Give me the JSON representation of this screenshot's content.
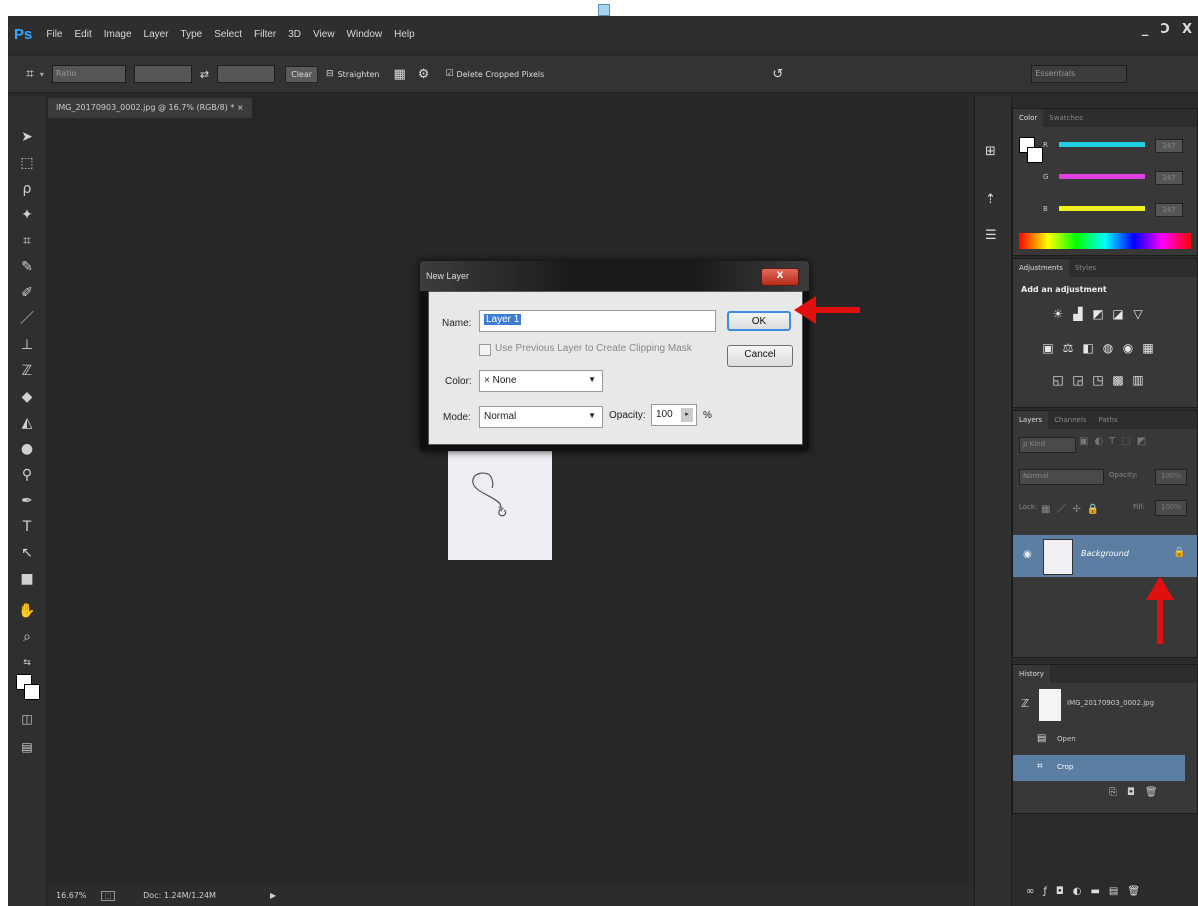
{
  "app": {
    "logo": "Ps",
    "menu": [
      "File",
      "Edit",
      "Image",
      "Layer",
      "Type",
      "Select",
      "Filter",
      "3D",
      "View",
      "Window",
      "Help"
    ],
    "window_controls": [
      "_",
      "Ɔ",
      "X"
    ]
  },
  "options_bar": {
    "ratio": "Ratio",
    "clear": "Clear",
    "straighten": "Straighten",
    "delete_cropped": "Delete Cropped Pixels",
    "workspace": "Essentials"
  },
  "document": {
    "tab_title": "IMG_20170903_0002.jpg @ 16.7% (RGB/8) * ×"
  },
  "status": {
    "zoom": "16.67%",
    "doc": "Doc: 1.24M/1.24M"
  },
  "color_panel": {
    "tabs": [
      "Color",
      "Swatches"
    ],
    "channels": [
      {
        "label": "R",
        "value": "247",
        "color": "#20d0e0"
      },
      {
        "label": "G",
        "value": "247",
        "color": "#e040e0"
      },
      {
        "label": "B",
        "value": "247",
        "color": "#f0f020"
      }
    ]
  },
  "adjustments_panel": {
    "tabs": [
      "Adjustments",
      "Styles"
    ],
    "heading": "Add an adjustment"
  },
  "layers_panel": {
    "tabs": [
      "Layers",
      "Channels",
      "Paths"
    ],
    "kind": "ρ Kind",
    "blend": "Normal",
    "opacity_label": "Opacity:",
    "opacity_value": "100%",
    "lock_label": "Lock:",
    "fill_label": "Fill:",
    "fill_value": "100%",
    "layer_name": "Background"
  },
  "history_panel": {
    "tab": "History",
    "snapshot": "IMG_20170903_0002.jpg",
    "steps": [
      "Open",
      "Crop"
    ]
  },
  "dialog": {
    "title": "New Layer",
    "close": "X",
    "name_label": "Name:",
    "name_value": "Layer 1",
    "clip_label": "Use Previous Layer to Create Clipping Mask",
    "color_label": "Color:",
    "color_value": "× None",
    "mode_label": "Mode:",
    "mode_value": "Normal",
    "opacity_label": "Opacity:",
    "opacity_value": "100",
    "percent": "%",
    "ok": "OK",
    "cancel": "Cancel"
  }
}
